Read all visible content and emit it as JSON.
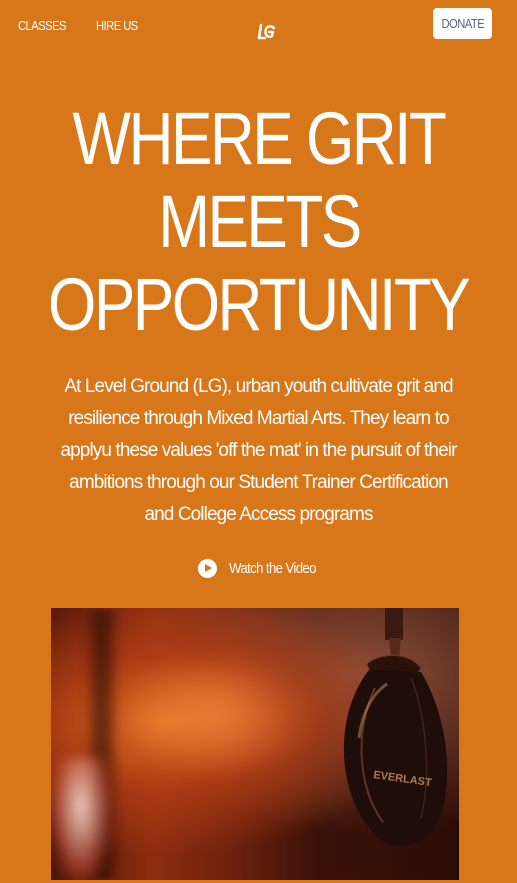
{
  "nav": {
    "classes_label": "CLASSES",
    "hire_label": "HIRE US",
    "logo_text": "LG",
    "donate_label": "DONATE"
  },
  "hero": {
    "headline_lines": [
      "WHERE GRIT",
      "MEETS",
      "OPPORTUNITY"
    ],
    "description": "At Level Ground (LG), urban youth cultivate grit and resilience through Mixed Martial Arts. They learn to applyu these values 'off the mat' in the pursuit of their ambitions through our Student Trainer Certification and College Access programs",
    "video_label": "Watch the Video",
    "photo_brand_text": "EVERLAST"
  },
  "colors": {
    "background": "#d8761a",
    "text": "#ffffff",
    "donate_text": "#5a6478"
  },
  "icons": {
    "logo": "lg-logo-icon",
    "play": "play-circle-icon"
  }
}
